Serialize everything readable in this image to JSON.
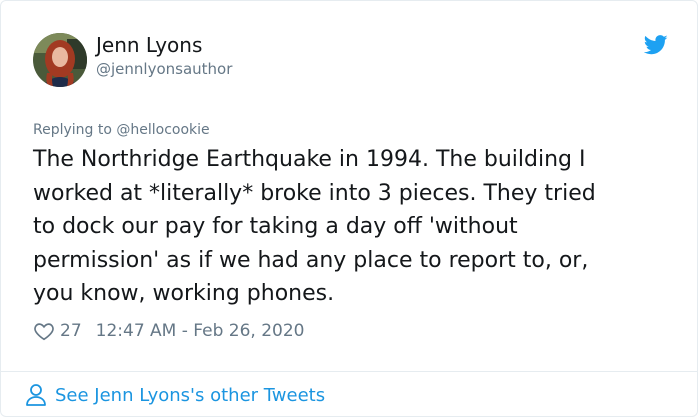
{
  "author": {
    "display_name": "Jenn Lyons",
    "handle": "@jennlyonsauthor"
  },
  "replying_to": "Replying to @hellocookie",
  "tweet": {
    "lines": [
      "The Northridge Earthquake in 1994. The building I",
      "worked at *literally* broke into 3 pieces. They tried",
      "to dock our pay for taking a day off 'without",
      "permission' as if we had any place to report to, or,",
      "you know, working phones."
    ]
  },
  "likes": "27",
  "timestamp": "12:47 AM - Feb 26, 2020",
  "footer": {
    "see_more": "See Jenn Lyons's other Tweets"
  },
  "icons": {
    "brand": "twitter-bird-icon",
    "like": "heart-outline-icon",
    "profile": "person-icon"
  },
  "colors": {
    "brand_blue": "#1da1f2",
    "link_blue": "#1b95e0",
    "secondary_text": "#657786",
    "primary_text": "#14171a",
    "border": "#e6ecf0"
  }
}
